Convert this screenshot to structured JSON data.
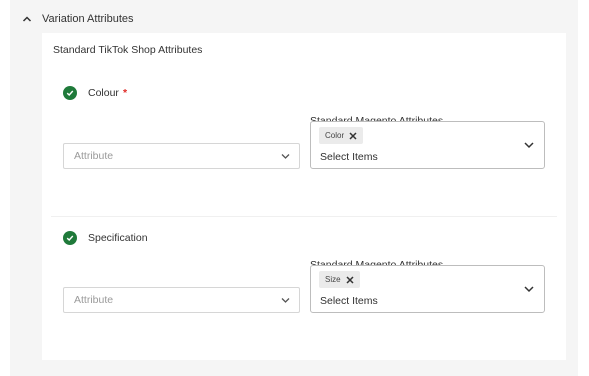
{
  "section": {
    "title": "Variation Attributes"
  },
  "card": {
    "title": "Standard TikTok Shop Attributes"
  },
  "groups": [
    {
      "name": "Colour",
      "required_mark": "*",
      "magento_label": "Standard Magento Attributes",
      "attribute_placeholder": "Attribute",
      "chip": "Color",
      "select_text": "Select Items"
    },
    {
      "name": "Specification",
      "required_mark": "",
      "magento_label": "Standard Magento Attributes",
      "attribute_placeholder": "Attribute",
      "chip": "Size",
      "select_text": "Select Items"
    }
  ],
  "colors": {
    "check": "#1f7a3a",
    "required": "#e02b27"
  },
  "icons": [
    "chevron-up-icon",
    "check-circle-icon",
    "chevron-down-icon",
    "close-icon"
  ]
}
